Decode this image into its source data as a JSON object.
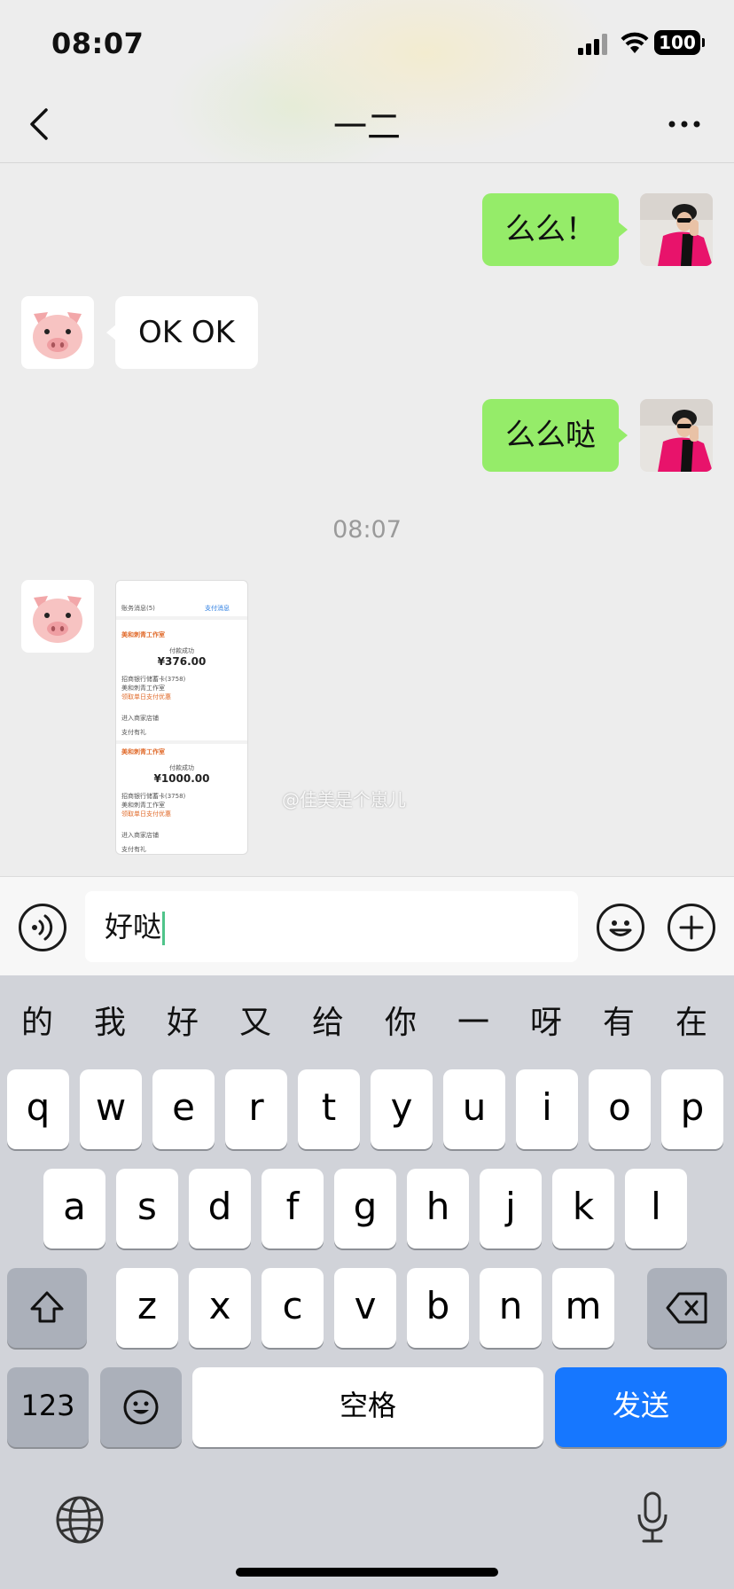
{
  "status_bar": {
    "time": "08:07",
    "battery": "100"
  },
  "header": {
    "title": "一二"
  },
  "messages": [
    {
      "side": "sent",
      "text": "么么！"
    },
    {
      "side": "received",
      "text": "OK OK"
    },
    {
      "side": "sent",
      "text": "么么哒"
    }
  ],
  "timestamp": "08:07",
  "image_message": {
    "tab_left": "账务消息(5)",
    "tab_right": "支付消息",
    "card1": {
      "merchant": "美和刺青工作室",
      "label": "付款成功",
      "amount": "¥376.00",
      "field1": "招商银行储蓄卡(3758)",
      "field2": "美和刺青工作室",
      "link": "领取单日支付优惠",
      "enter": "进入商家店铺",
      "pay": "支付有礼"
    },
    "card2": {
      "merchant": "美和刺青工作室",
      "label": "付款成功",
      "amount": "¥1000.00",
      "field1": "招商银行储蓄卡(3758)",
      "field2": "美和刺青工作室",
      "link": "领取单日支付优惠",
      "enter": "进入商家店铺",
      "pay": "支付有礼"
    }
  },
  "watermark": "@佳美是个崽儿",
  "input": {
    "value": "好哒"
  },
  "keyboard": {
    "candidates": [
      "的",
      "我",
      "好",
      "又",
      "给",
      "你",
      "一",
      "呀",
      "有",
      "在"
    ],
    "row1": [
      "q",
      "w",
      "e",
      "r",
      "t",
      "y",
      "u",
      "i",
      "o",
      "p"
    ],
    "row2": [
      "a",
      "s",
      "d",
      "f",
      "g",
      "h",
      "j",
      "k",
      "l"
    ],
    "row3": [
      "z",
      "x",
      "c",
      "v",
      "b",
      "n",
      "m"
    ],
    "numbers_label": "123",
    "space_label": "空格",
    "send_label": "发送"
  },
  "colors": {
    "sent_bubble": "#95ec69",
    "send_key": "#1677ff"
  }
}
